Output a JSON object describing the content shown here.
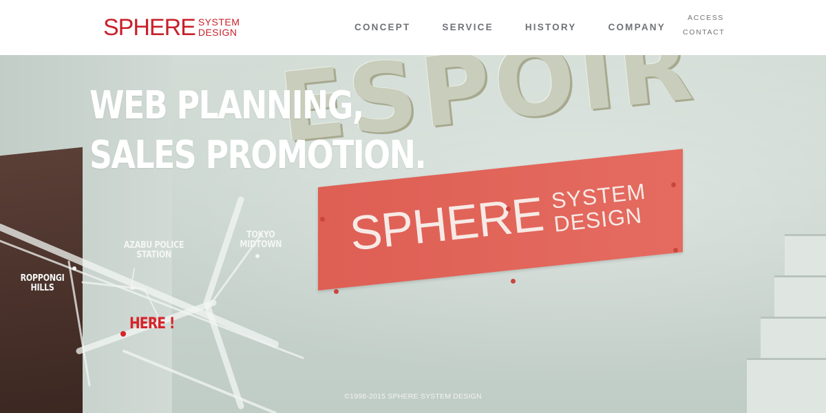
{
  "header": {
    "logo": {
      "main": "SPHERE",
      "sub1": "SYSTEM",
      "sub2": "DESIGN",
      "color": "#c8202a"
    },
    "nav_main": [
      {
        "label": "CONCEPT"
      },
      {
        "label": "SERVICE"
      },
      {
        "label": "HISTORY"
      },
      {
        "label": "COMPANY"
      }
    ],
    "nav_sub": [
      {
        "label": "ACCESS"
      },
      {
        "label": "CONTACT"
      }
    ]
  },
  "hero": {
    "headline_line1": "WEB PLANNING,",
    "headline_line2": "SALES PROMOTION.",
    "wall_sign": "ESPOIR",
    "sign": {
      "main": "SPHERE",
      "sub1": "SYSTEM",
      "sub2": "DESIGN",
      "color": "#e06257"
    },
    "map": {
      "labels": [
        {
          "key": "azabu",
          "line1": "AZABU POLICE",
          "line2": "STATION"
        },
        {
          "key": "tokyo",
          "line1": "TOKYO",
          "line2": "MIDTOWN"
        },
        {
          "key": "roppongi",
          "line1": "ROPPONGI",
          "line2": "HILLS"
        }
      ],
      "here": "HERE !",
      "here_color": "#d8232a"
    }
  },
  "footer": {
    "copyright": "©1998-2015 SPHERE SYSTEM DESIGN"
  }
}
